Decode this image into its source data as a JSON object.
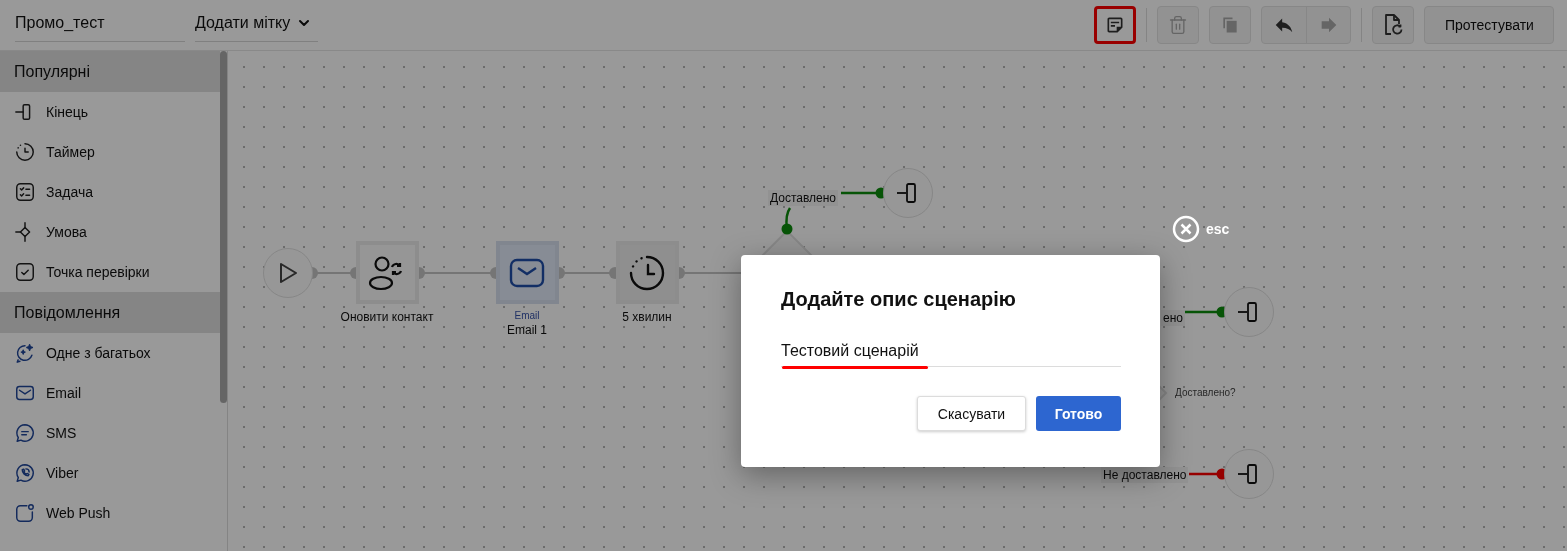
{
  "header": {
    "scenario_name": "Промо_тест",
    "tag_select": "Додати мітку"
  },
  "toolbar": {
    "buttons": [
      {
        "kind": "note",
        "highlighted": true,
        "disabled": false
      },
      {
        "kind": "trash",
        "highlighted": false,
        "disabled": true
      },
      {
        "kind": "copy",
        "highlighted": false,
        "disabled": true
      },
      {
        "kind": "undo",
        "disabled": false
      },
      {
        "kind": "redo",
        "disabled": true
      },
      {
        "kind": "restore",
        "highlighted": false,
        "disabled": false
      }
    ],
    "test_button": "Протестувати"
  },
  "sidebar": {
    "sections": [
      {
        "title": "Популярні",
        "items": [
          {
            "label": "Кінець",
            "kind": "end"
          },
          {
            "label": "Таймер",
            "kind": "timer"
          },
          {
            "label": "Задача",
            "kind": "task"
          },
          {
            "label": "Умова",
            "kind": "condition"
          },
          {
            "label": "Точка перевірки",
            "kind": "checkpoint"
          }
        ]
      },
      {
        "title": "Повідомлення",
        "items": [
          {
            "label": "Одне з багатьох",
            "kind": "one_of_many"
          },
          {
            "label": "Email",
            "kind": "email"
          },
          {
            "label": "SMS",
            "kind": "sms"
          },
          {
            "label": "Viber",
            "kind": "viber"
          },
          {
            "label": "Web Push",
            "kind": "web_push"
          }
        ]
      }
    ]
  },
  "flow": {
    "steps": [
      {
        "kind": "start"
      },
      {
        "kind": "update_contact",
        "label": "Оновити контакт",
        "selected": false
      },
      {
        "kind": "email",
        "type_label": "Email",
        "label": "Email 1",
        "selected": true
      },
      {
        "kind": "timer",
        "label": "5 хвилин",
        "selected": false
      }
    ],
    "branches": [
      {
        "label": "Доставлено",
        "color": "#085408"
      },
      {
        "label": "ено",
        "color": "#085408"
      },
      {
        "label": "Не доставлено",
        "color": "#960000"
      }
    ],
    "condition_label": "Доставлено?"
  },
  "close": {
    "label": "esc"
  },
  "modal": {
    "title": "Додайте опис сценарію",
    "input": {
      "value": "Тестовий сценарій",
      "highlighted": true
    },
    "cancel_button": "Скасувати",
    "confirm_button": "Готово"
  }
}
